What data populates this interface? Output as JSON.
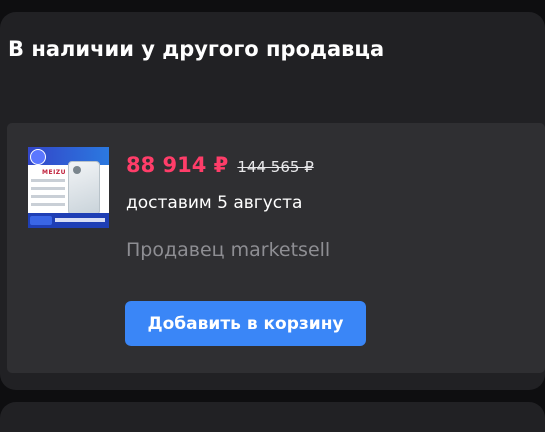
{
  "section": {
    "title": "В наличии у другого продавца"
  },
  "offer": {
    "image_icon": "product-photo-meizu-phone",
    "image_text": [
      "MEIZU",
      "meizu Note 21 Pro",
      "NFC"
    ],
    "price_current": "88 914 ₽",
    "price_old": "144 565 ₽",
    "delivery": "доставим 5 августа",
    "seller": "Продавец marketsell",
    "add_to_cart_label": "Добавить в корзину"
  },
  "colors": {
    "accent_button": "#3a86f7",
    "price": "#ff3d69",
    "background": "#0e0e10",
    "card": "#2f2f32"
  }
}
